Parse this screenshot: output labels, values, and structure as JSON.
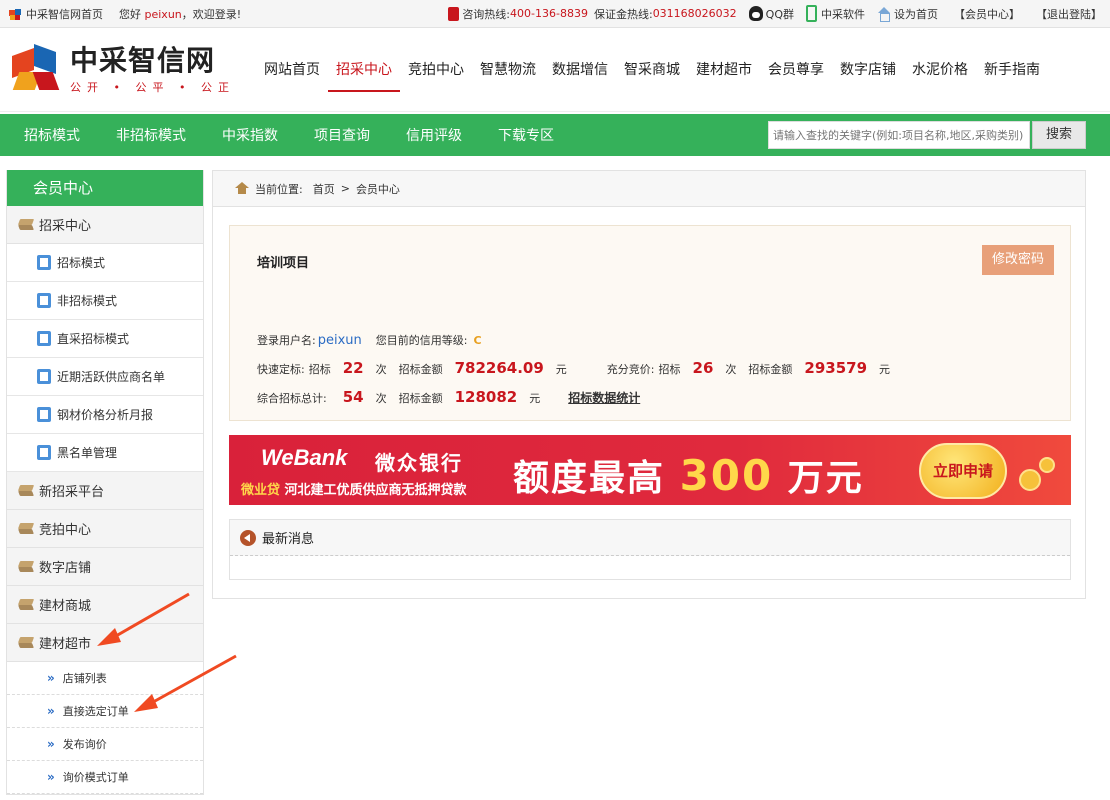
{
  "topbar": {
    "home_link": "中采智信网首页",
    "greeting_prefix": "您好",
    "username": "peixun",
    "greeting_suffix": "，欢迎登录!",
    "hotline_label": "咨询热线:",
    "hotline_number": "400-136-8839",
    "deposit_label": "保证金热线:",
    "deposit_number": "031168026032",
    "qq_group": "QQ群",
    "software": "中采软件",
    "set_home": "设为首页",
    "member_center": "【会员中心】",
    "logout": "【退出登陆】"
  },
  "logo": {
    "name": "中采智信网",
    "slogan": "公开 • 公平 • 公正"
  },
  "main_nav": [
    {
      "label": "网站首页"
    },
    {
      "label": "招采中心"
    },
    {
      "label": "竞拍中心"
    },
    {
      "label": "智慧物流"
    },
    {
      "label": "数据增信"
    },
    {
      "label": "智采商城"
    },
    {
      "label": "建材超市"
    },
    {
      "label": "会员尊享"
    },
    {
      "label": "数字店铺"
    },
    {
      "label": "水泥价格"
    },
    {
      "label": "新手指南"
    }
  ],
  "active_nav": "招采中心",
  "sub_nav": [
    {
      "label": "招标模式"
    },
    {
      "label": "非招标模式"
    },
    {
      "label": "中采指数"
    },
    {
      "label": "项目查询"
    },
    {
      "label": "信用评级"
    },
    {
      "label": "下载专区"
    }
  ],
  "search": {
    "placeholder": "请输入查找的关键字(例如:项目名称,地区,采购类别)",
    "button": "搜索"
  },
  "sidebar": {
    "title": "会员中心",
    "section_zhaocai": "招采中心",
    "zhaocai_items": [
      {
        "label": "招标模式"
      },
      {
        "label": "非招标模式"
      },
      {
        "label": "直采招标模式"
      },
      {
        "label": "近期活跃供应商名单"
      },
      {
        "label": "钢材价格分析月报"
      },
      {
        "label": "黑名单管理"
      }
    ],
    "sections_mid": [
      {
        "label": "新招采平台"
      },
      {
        "label": "竞拍中心"
      },
      {
        "label": "数字店铺"
      },
      {
        "label": "建材商城"
      },
      {
        "label": "建材超市"
      }
    ],
    "jiancai_items": [
      {
        "label": "店铺列表"
      },
      {
        "label": "直接选定订单"
      },
      {
        "label": "发布询价"
      },
      {
        "label": "询价模式订单"
      }
    ]
  },
  "breadcrumb": {
    "label": "当前位置:",
    "home": "首页",
    "separator": ">",
    "current": "会员中心"
  },
  "info": {
    "project_title": "培训项目",
    "change_password": "修改密码",
    "login_user_label": "登录用户名:",
    "login_user": "peixun",
    "credit_label": "您目前的信用等级:",
    "credit_grade": "C",
    "quick_label": "快速定标:",
    "quick_bid_label": "招标",
    "quick_count": "22",
    "times": "次",
    "amount_label": "招标金额",
    "quick_amount": "782264.09",
    "yuan": "元",
    "full_label": "充分竞价:",
    "full_bid_label": "招标",
    "full_count": "26",
    "full_amount": "293579",
    "total_label": "综合招标总计:",
    "total_count": "54",
    "total_amount": "128082",
    "stats_link": "招标数据统计"
  },
  "banner": {
    "brand": "WeBank",
    "brand_cn": "微众银行",
    "product": "微业贷",
    "desc": "河北建工优质供应商无抵押贷款",
    "headline_prefix": "额度最高",
    "headline_amount": "300",
    "headline_suffix": "万元",
    "cta": "立即申请"
  },
  "news": {
    "title": "最新消息"
  },
  "colors": {
    "accent_green": "#35b15a",
    "brand_red": "#c8161d",
    "link_blue": "#2b6cc4",
    "annotation_arrow": "#f04a22"
  }
}
